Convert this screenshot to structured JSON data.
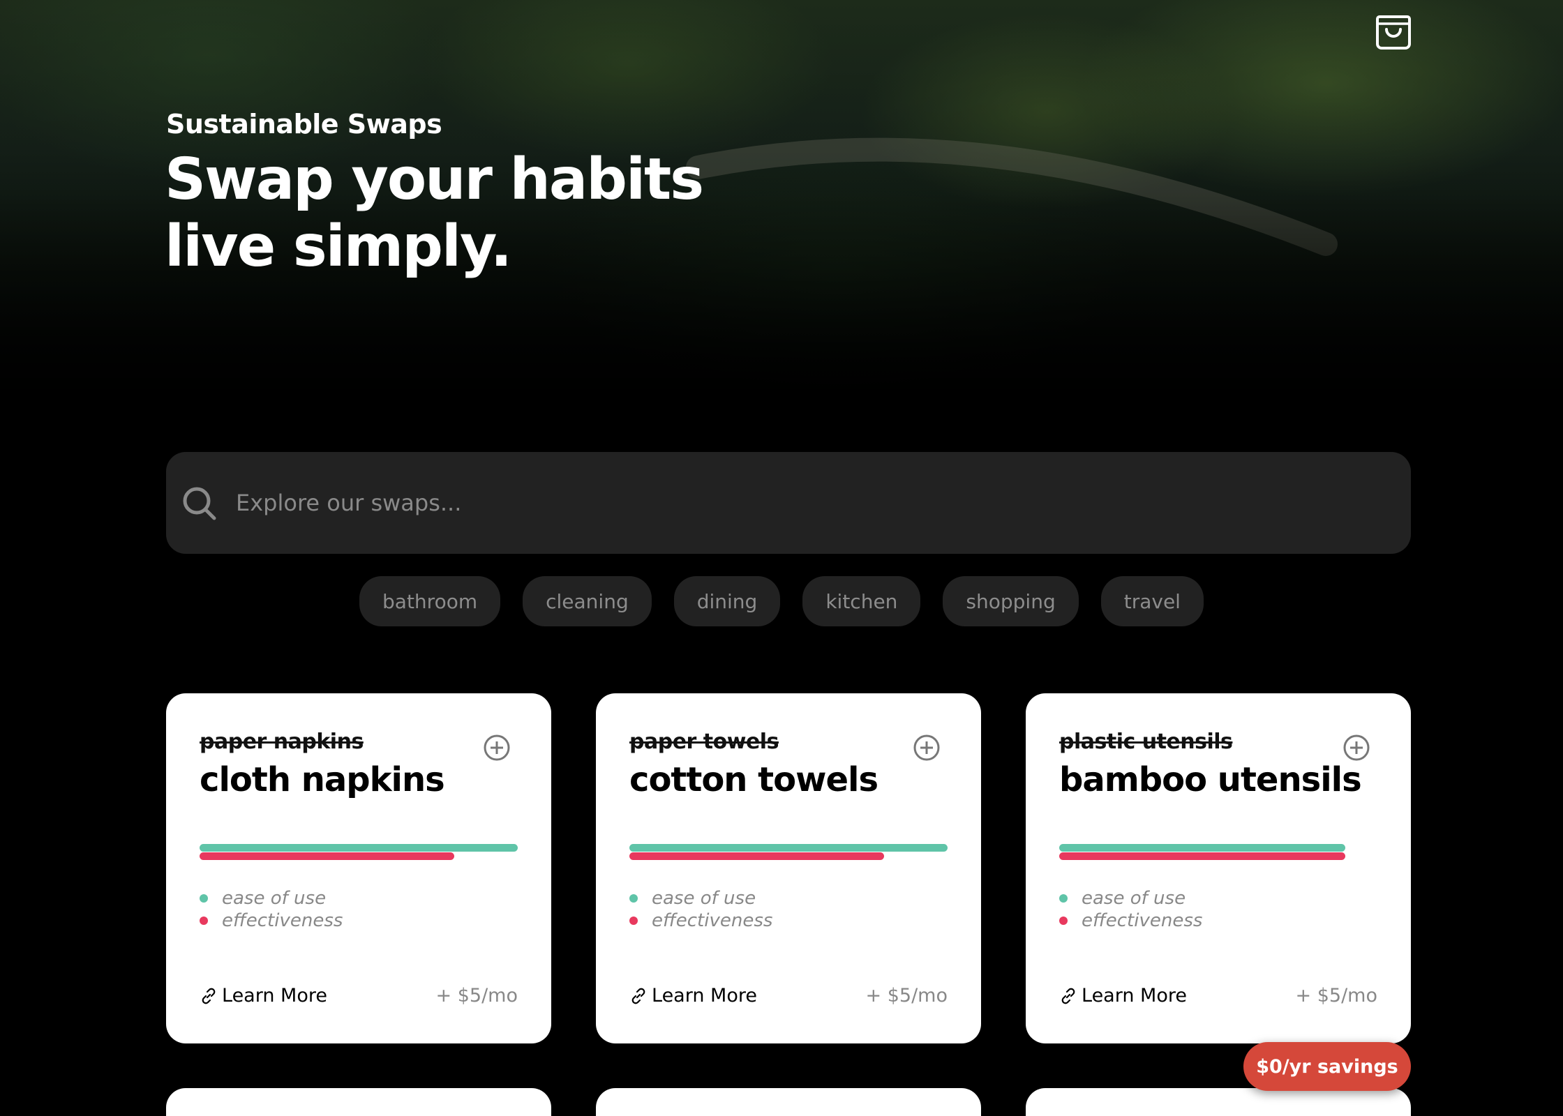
{
  "header": {
    "kicker": "Sustainable Swaps",
    "headline_line1": "Swap your habits",
    "headline_line2": "live simply.",
    "cart_icon": "shopping-bag-icon"
  },
  "search": {
    "placeholder": "Explore our swaps...",
    "icon": "search-icon"
  },
  "tags": [
    "bathroom",
    "cleaning",
    "dining",
    "kitchen",
    "shopping",
    "travel"
  ],
  "colors": {
    "ease_of_use": "#5fc4a8",
    "effectiveness": "#e8395e",
    "savings_badge": "#d5483a"
  },
  "cards": [
    {
      "old_item": "paper napkins",
      "new_item": "cloth napkins",
      "ease_of_use": 1.0,
      "effectiveness": 0.8,
      "legend_ease": "ease of use",
      "legend_effectiveness": "effectiveness",
      "learn_more": "Learn More",
      "price": "+ $5/mo"
    },
    {
      "old_item": "paper towels",
      "new_item": "cotton towels",
      "ease_of_use": 1.0,
      "effectiveness": 0.8,
      "legend_ease": "ease of use",
      "legend_effectiveness": "effectiveness",
      "learn_more": "Learn More",
      "price": "+ $5/mo"
    },
    {
      "old_item": "plastic utensils",
      "new_item": "bamboo utensils",
      "ease_of_use": 1.0,
      "effectiveness": 1.0,
      "legend_ease": "ease of use",
      "legend_effectiveness": "effectiveness",
      "learn_more": "Learn More",
      "price": "+ $5/mo"
    }
  ],
  "savings_badge": "$0/yr savings"
}
